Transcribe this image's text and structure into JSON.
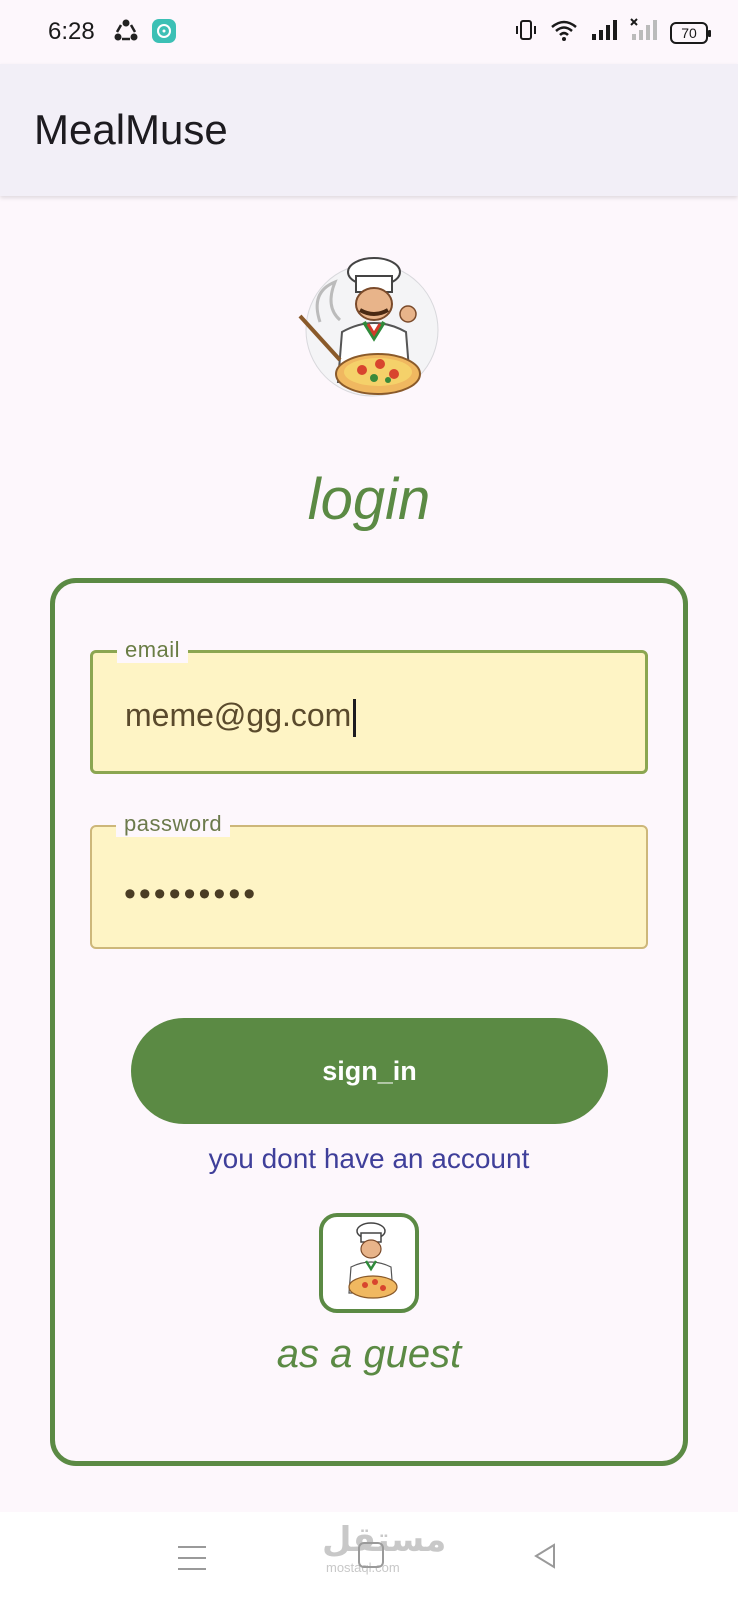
{
  "status_bar": {
    "time": "6:28",
    "left_icons": [
      "sync-icon",
      "chat-app-icon"
    ],
    "right_icons": [
      "vibrate-icon",
      "wifi-icon",
      "signal-icon",
      "signal-no-service-icon"
    ],
    "battery": "70"
  },
  "app_bar": {
    "title": "MealMuse"
  },
  "login": {
    "title": "login",
    "email": {
      "label": "email",
      "value": "meme@gg.com"
    },
    "password": {
      "label": "password",
      "value": "•••••••••"
    },
    "sign_in_label": "sign_in",
    "signup_link": "you dont have an account",
    "guest_label": "as a guest"
  },
  "watermark": {
    "text": "مستقل",
    "sub": "mostaql.com"
  },
  "colors": {
    "accent": "#5b8a44",
    "field_bg": "#fef4c5",
    "link": "#3f3f9a",
    "background": "#fdf7fc"
  }
}
